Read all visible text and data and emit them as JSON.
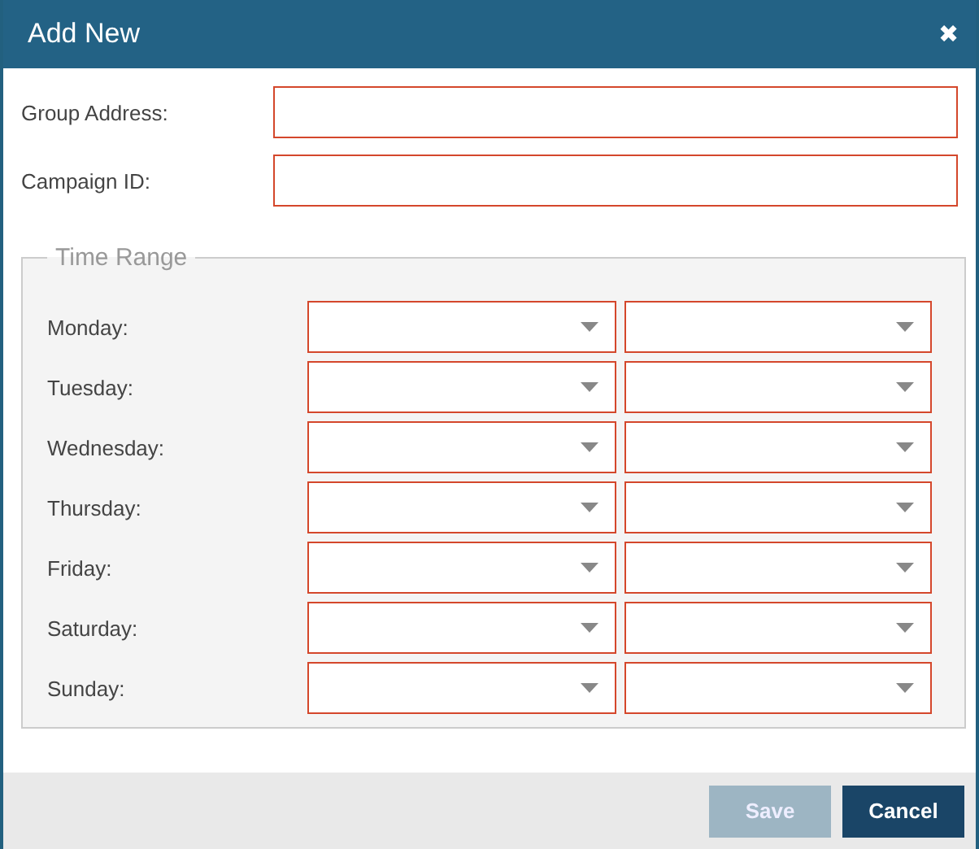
{
  "window": {
    "title": "Add New",
    "close_icon": "✖"
  },
  "fields": [
    {
      "label": "Group Address:",
      "invalid": true
    },
    {
      "label": "Campaign ID:",
      "invalid": true
    }
  ],
  "time_range": {
    "legend": "Time Range",
    "days": [
      {
        "label": "Monday:",
        "from_invalid": true,
        "to_invalid": true
      },
      {
        "label": "Tuesday:",
        "from_invalid": true,
        "to_invalid": true
      },
      {
        "label": "Wednesday:",
        "from_invalid": true,
        "to_invalid": true
      },
      {
        "label": "Thursday:",
        "from_invalid": true,
        "to_invalid": true
      },
      {
        "label": "Friday:",
        "from_invalid": true,
        "to_invalid": true
      },
      {
        "label": "Saturday:",
        "from_invalid": true,
        "to_invalid": true
      },
      {
        "label": "Sunday:",
        "from_invalid": true,
        "to_invalid": true
      }
    ]
  },
  "buttons": [
    {
      "label": "Save",
      "disabled": true
    },
    {
      "label": "Cancel",
      "disabled": false
    }
  ]
}
